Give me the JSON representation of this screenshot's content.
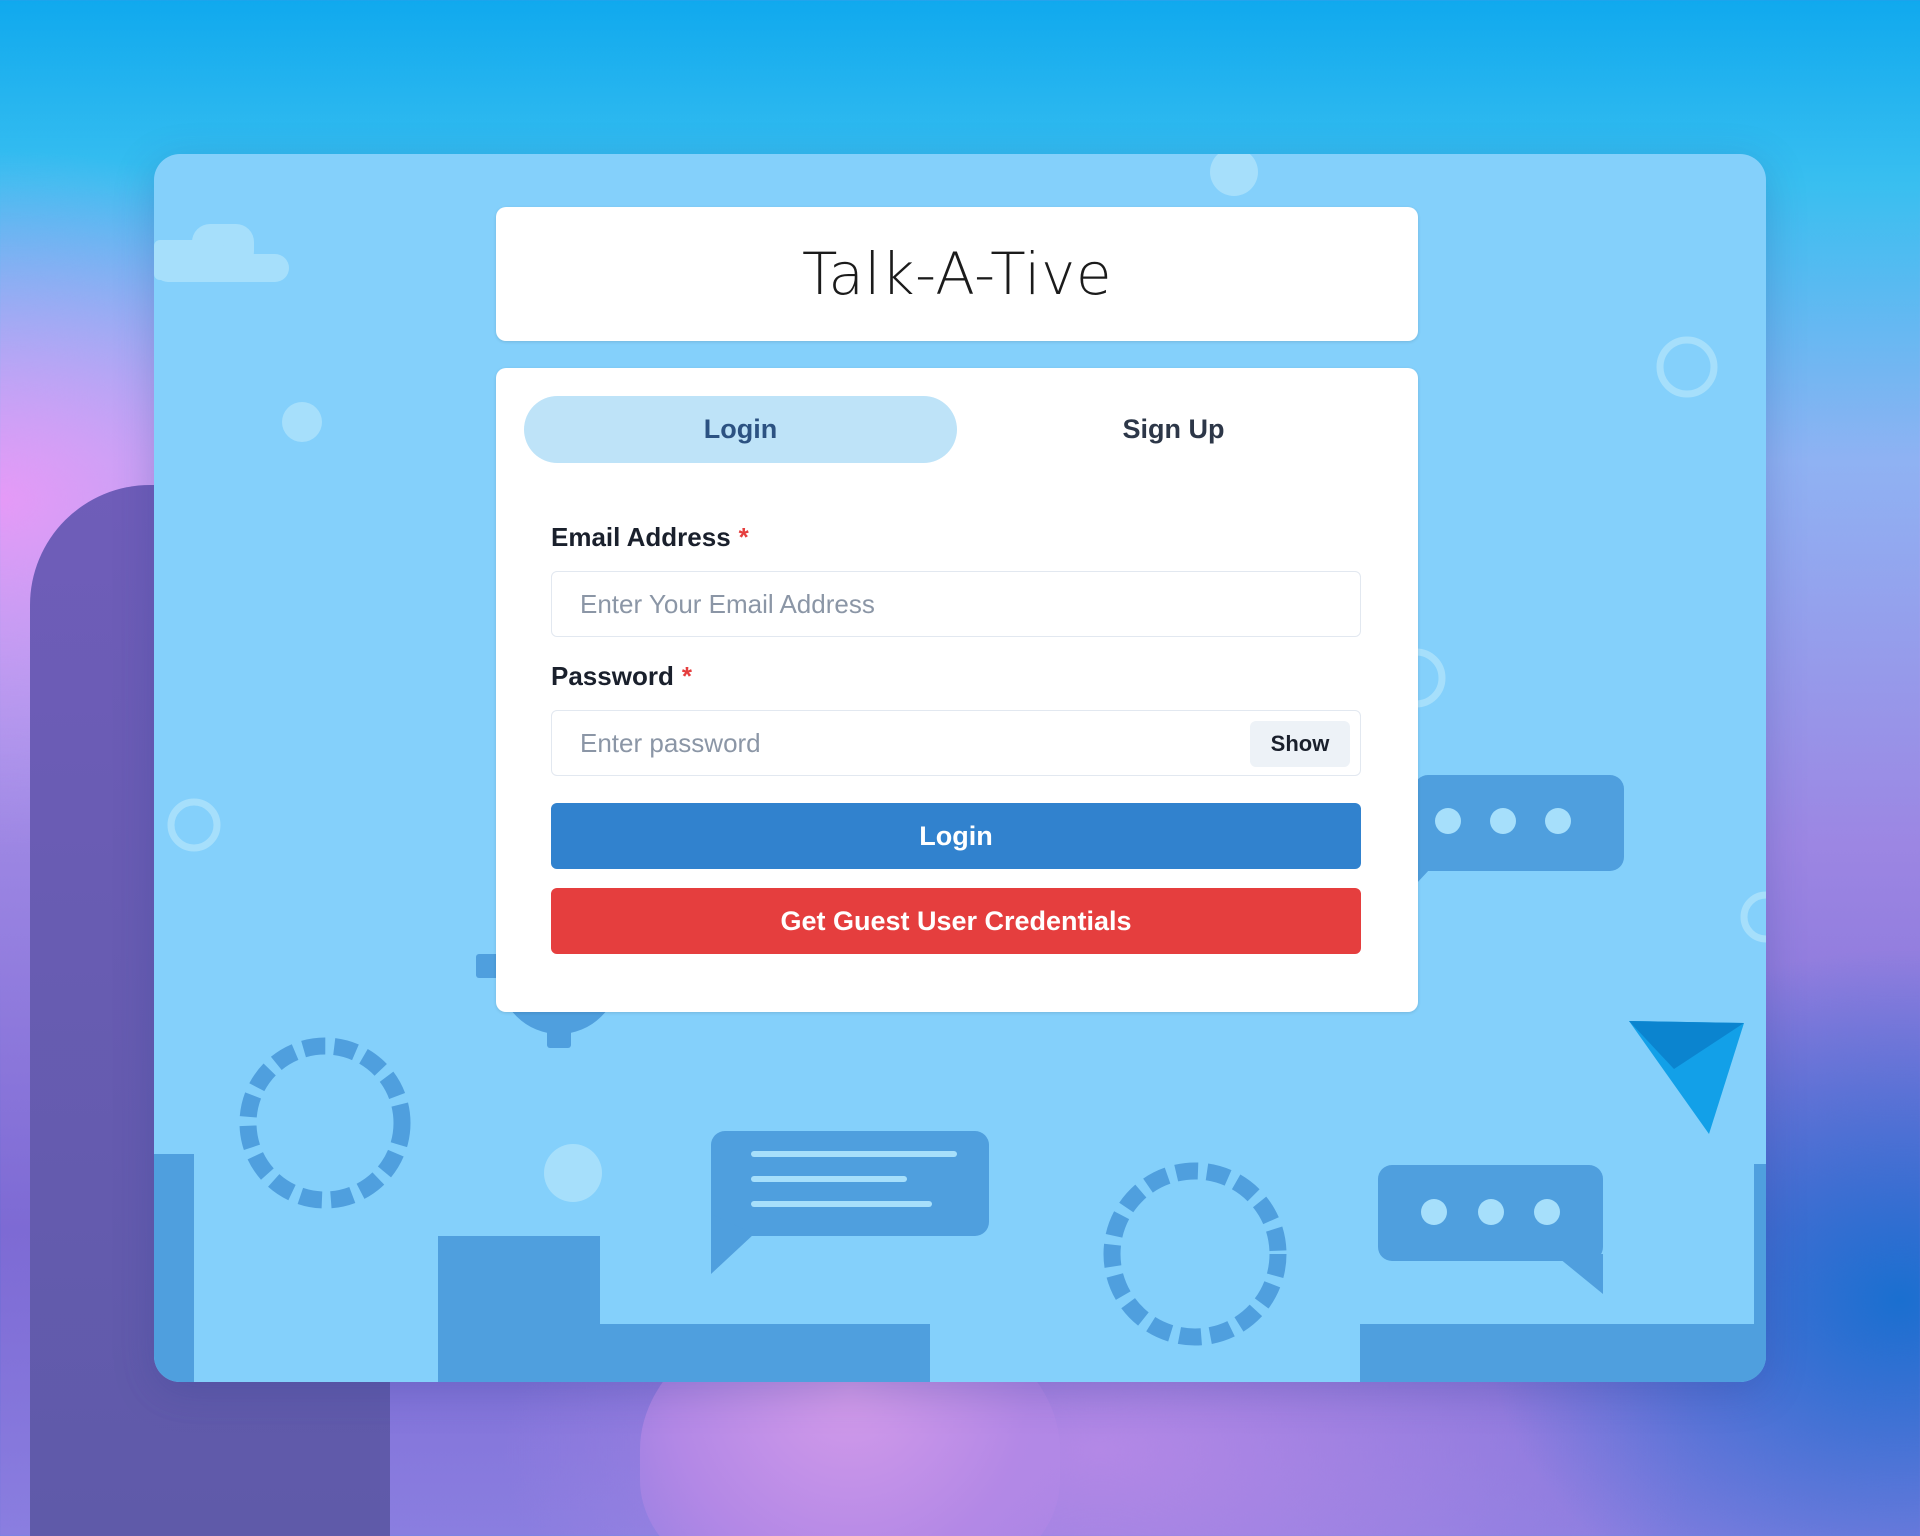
{
  "app": {
    "title": "Talk-A-Tive"
  },
  "tabs": [
    {
      "label": "Login",
      "active": true
    },
    {
      "label": "Sign Up",
      "active": false
    }
  ],
  "login_form": {
    "email": {
      "label": "Email Address",
      "required_mark": "*",
      "placeholder": "Enter Your Email Address",
      "value": ""
    },
    "password": {
      "label": "Password",
      "required_mark": "*",
      "placeholder": "Enter password",
      "value": "",
      "toggle_label": "Show"
    },
    "submit_label": "Login",
    "guest_label": "Get Guest User Credentials"
  },
  "colors": {
    "frame_background": "#84d0fb",
    "tab_active_bg": "#bee3f8",
    "login_button": "#3182ce",
    "guest_button": "#e53e3e",
    "required_mark": "#e53e3e"
  },
  "icons": [
    "chat-bubble-dots-icon",
    "chat-bubble-lines-icon",
    "paper-plane-icon",
    "gear-icon",
    "dashed-ring-icon",
    "cloud-icon"
  ]
}
